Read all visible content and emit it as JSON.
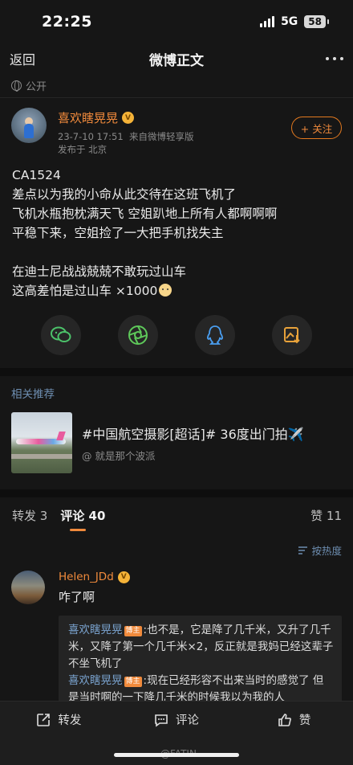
{
  "status_bar": {
    "time": "22:25",
    "network": "5G",
    "battery": "58"
  },
  "nav": {
    "back_label": "返回",
    "title": "微博正文"
  },
  "visibility": {
    "label": "公开"
  },
  "post": {
    "author": "喜欢瞎晃晃",
    "timestamp": "23-7-10 17:51",
    "source": "来自微博轻享版",
    "location": "发布于 北京",
    "follow_label": "+ 关注",
    "lines": [
      "CA1524",
      "差点以为我的小命从此交待在这班飞机了",
      "飞机水瓶抱枕满天飞  空姐趴地上所有人都啊啊啊",
      "平稳下来，空姐捡了一大把手机找失主",
      "",
      "在迪士尼战战兢兢不敢玩过山车",
      "这高差怕是过山车 ×1000"
    ]
  },
  "share": {
    "items": [
      "wechat-icon",
      "moments-icon",
      "qq-icon",
      "save-image-icon"
    ]
  },
  "recommend": {
    "section_title": "相关推荐",
    "title": "#中国航空摄影[超话]# 36度出门拍✈️",
    "subtitle": "@ 就是那个波派"
  },
  "tabs": {
    "repost": "转发 3",
    "comment": "评论 40",
    "like": "赞 11"
  },
  "sort": {
    "label": "按热度"
  },
  "comment": {
    "author": "Helen_JDd",
    "text": "咋了啊",
    "replies": [
      {
        "name": "喜欢瞎晃晃",
        "badge": "博主",
        "text": ":也不是，它是降了几千米，又升了几千米，又降了第一个几千米×2，反正就是我妈已经这辈子不坐飞机了"
      },
      {
        "name": "喜欢瞎晃晃",
        "badge": "博主",
        "text": ":现在已经形容不出来当时的感觉了 但是当时啊的一下降几千米的时候我以为我的人"
      }
    ]
  },
  "bottom_bar": {
    "repost_label": "转发",
    "comment_label": "评论",
    "like_label": "赞",
    "watermark": "@FATIN"
  },
  "colors": {
    "accent": "#f08a3c",
    "link": "#7aa3cf",
    "background": "#161616"
  }
}
